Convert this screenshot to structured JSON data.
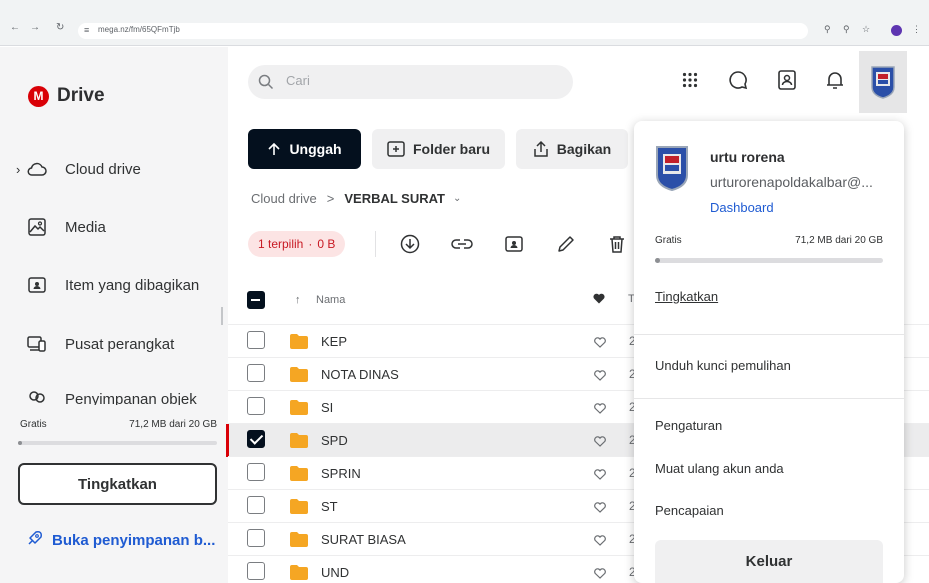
{
  "browser": {
    "url": "mega.nz/fm/65QFmTjb"
  },
  "sidebar": {
    "logo_letter": "M",
    "logo_text": "Drive",
    "items": [
      {
        "label": "Cloud drive",
        "icon": "cloud-icon"
      },
      {
        "label": "Media",
        "icon": "image-icon"
      },
      {
        "label": "Item yang dibagikan",
        "icon": "shared-folder-icon"
      },
      {
        "label": "Pusat perangkat",
        "icon": "devices-icon"
      },
      {
        "label": "Penyimpanan objek",
        "icon": "object-storage-icon"
      }
    ],
    "storage": {
      "label": "Gratis",
      "usage": "71,2 MB dari 20 GB",
      "fraction": 0.004
    },
    "upgrade_label": "Tingkatkan",
    "open_storage_label": "Buka penyimpanan b..."
  },
  "header": {
    "search_placeholder": "Cari"
  },
  "toolbar": {
    "upload_label": "Unggah",
    "new_folder_label": "Folder baru",
    "share_label": "Bagikan"
  },
  "breadcrumb": {
    "root": "Cloud drive",
    "separator": ">",
    "current": "VERBAL SURAT"
  },
  "selection": {
    "count_label": "1 terpilih",
    "dot": "·",
    "size": "0 B"
  },
  "table": {
    "name_header": "Nama",
    "date_header_partial": "T",
    "rows": [
      {
        "name": "KEP",
        "date_partial": "2",
        "selected": false
      },
      {
        "name": "NOTA DINAS",
        "date_partial": "2",
        "selected": false
      },
      {
        "name": "SI",
        "date_partial": "2",
        "selected": false
      },
      {
        "name": "SPD",
        "date_partial": "2",
        "selected": true
      },
      {
        "name": "SPRIN",
        "date_partial": "2",
        "selected": false
      },
      {
        "name": "ST",
        "date_partial": "2",
        "selected": false
      },
      {
        "name": "SURAT BIASA",
        "date_partial": "2",
        "selected": false
      },
      {
        "name": "UND",
        "date_partial": "2:",
        "selected": false
      }
    ]
  },
  "account_menu": {
    "name": "urtu rorena",
    "email": "urturorenapoldakalbar@...",
    "dashboard_label": "Dashboard",
    "plan": "Gratis",
    "usage": "71,2 MB dari 20 GB",
    "fraction": 0.004,
    "upgrade_label": "Tingkatkan",
    "recovery_key_label": "Unduh kunci pemulihan",
    "settings_label": "Pengaturan",
    "reload_label": "Muat ulang akun anda",
    "achievements_label": "Pencapaian",
    "logout_label": "Keluar"
  },
  "colors": {
    "brand_red": "#d90007",
    "primary_dark": "#04101e",
    "link_blue": "#1f5bd2",
    "selection_badge_bg": "#fce4e4"
  }
}
